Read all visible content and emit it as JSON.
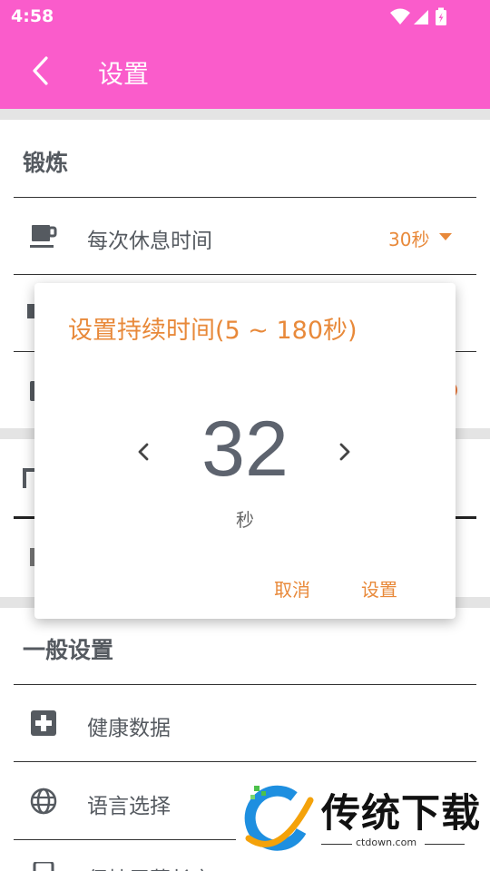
{
  "status_bar": {
    "time": "4:58"
  },
  "app_bar": {
    "title": "设置"
  },
  "sections": {
    "exercise": {
      "title": "锻炼",
      "rest_time_label": "每次休息时间",
      "rest_time_value": "30秒"
    },
    "general": {
      "title": "一般设置",
      "health_label": "健康数据",
      "language_label": "语言选择",
      "partial_label": "保持屏幕长亮"
    }
  },
  "dialog": {
    "title": "设置持续时间(5 ~ 180秒)",
    "value": "32",
    "unit": "秒",
    "cancel_label": "取消",
    "confirm_label": "设置"
  },
  "watermark": {
    "text": "传统下载",
    "url": "ctdown.com"
  },
  "colors": {
    "accent_pink": "#fa5ccb",
    "accent_orange": "#e8893a",
    "text_gray": "#555a60"
  }
}
